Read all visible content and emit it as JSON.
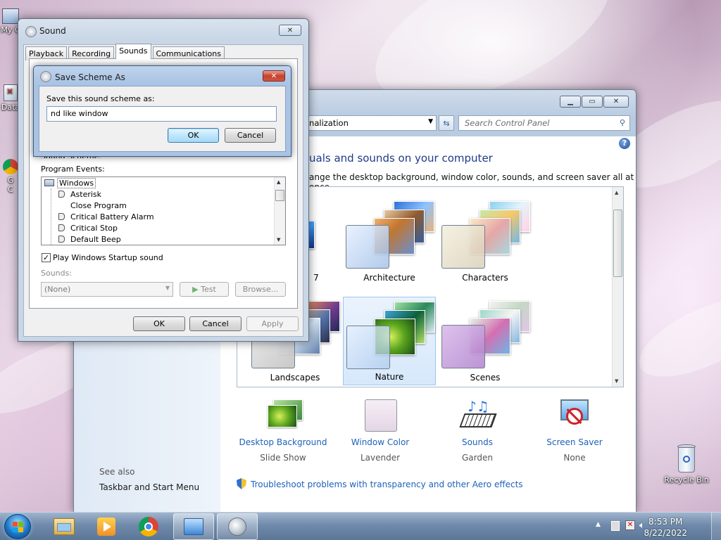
{
  "desktop": {
    "icons": [
      {
        "label": "My C"
      },
      {
        "label": "Data"
      },
      {
        "label": "G"
      },
      {
        "label": "C"
      }
    ],
    "recycle_bin": {
      "label": "Recycle Bin"
    }
  },
  "control_panel": {
    "address": "onalization",
    "search_placeholder": "Search Control Panel",
    "heading": "uals and sounds on your computer",
    "subtext": "ange the desktop background, window color, sounds, and screen saver all at once.",
    "themes": [
      {
        "label": "7"
      },
      {
        "label": "Architecture"
      },
      {
        "label": "Characters"
      },
      {
        "label": "Landscapes"
      },
      {
        "label": "Nature"
      },
      {
        "label": "Scenes"
      }
    ],
    "bottom_items": [
      {
        "title": "Desktop Background",
        "subtitle": "Slide Show",
        "icon": "desktop-background-icon"
      },
      {
        "title": "Window Color",
        "subtitle": "Lavender",
        "icon": "window-color-icon"
      },
      {
        "title": "Sounds",
        "subtitle": "Garden",
        "icon": "sounds-icon"
      },
      {
        "title": "Screen Saver",
        "subtitle": "None",
        "icon": "screen-saver-icon"
      }
    ],
    "see_also": "See also",
    "see_also_link": "Taskbar and Start Menu",
    "troubleshoot": "Troubleshoot problems with transparency and other Aero effects"
  },
  "sound_dialog": {
    "title": "Sound",
    "tabs": [
      "Playback",
      "Recording",
      "Sounds",
      "Communications"
    ],
    "active_tab": "Sounds",
    "scheme_label": "Sound Scheme:",
    "program_events_label": "Program Events:",
    "events": [
      {
        "label": "Windows"
      },
      {
        "label": "Asterisk"
      },
      {
        "label": "Close Program"
      },
      {
        "label": "Critical Battery Alarm"
      },
      {
        "label": "Critical Stop"
      },
      {
        "label": "Default Beep"
      }
    ],
    "startup_checkbox": "Play Windows Startup sound",
    "startup_checked": true,
    "sounds_label": "Sounds:",
    "sounds_value": "(None)",
    "test_button": "Test",
    "browse_button": "Browse...",
    "ok": "OK",
    "cancel": "Cancel",
    "apply": "Apply"
  },
  "save_scheme_dialog": {
    "title": "Save Scheme As",
    "prompt": "Save this sound scheme as:",
    "value": "nd like window",
    "ok": "OK",
    "cancel": "Cancel"
  },
  "taskbar": {
    "time": "8:53 PM",
    "date": "8/22/2022"
  },
  "colors": {
    "link": "#1c62b9",
    "heading": "#1e3a8a",
    "close_red": "#c6422d"
  }
}
